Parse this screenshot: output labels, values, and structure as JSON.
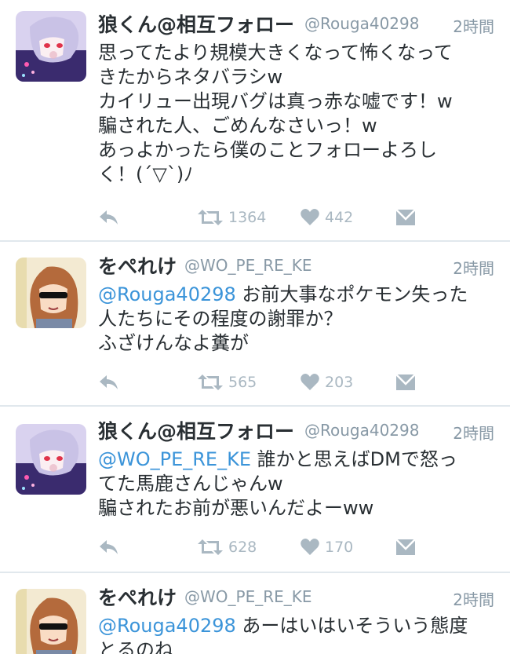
{
  "tweets": [
    {
      "name": "狼くん@相互フォロー",
      "handle": "@Rouga40298",
      "time": "2時間",
      "lines": [
        {
          "mention": "",
          "text": "思ってたより規模大きくなって怖くなって"
        },
        {
          "mention": "",
          "text": "きたからネタバラシw"
        },
        {
          "mention": "",
          "text": "カイリュー出現バグは真っ赤な嘘です！w"
        },
        {
          "mention": "",
          "text": "騙された人、ごめんなさいっ！w"
        },
        {
          "mention": "",
          "text": "あっよかったら僕のことフォローよろし"
        },
        {
          "mention": "",
          "text": "く！(´▽`)ﾉ"
        }
      ],
      "retweets": "1364",
      "likes": "442"
    },
    {
      "name": "をぺれけ",
      "handle": "@WO_PE_RE_KE",
      "time": "2時間",
      "lines": [
        {
          "mention": "@Rouga40298",
          "text": " お前大事なポケモン失った"
        },
        {
          "mention": "",
          "text": "人たちにその程度の謝罪か？"
        },
        {
          "mention": "",
          "text": "ふざけんなよ糞が"
        }
      ],
      "retweets": "565",
      "likes": "203"
    },
    {
      "name": "狼くん@相互フォロー",
      "handle": "@Rouga40298",
      "time": "2時間",
      "lines": [
        {
          "mention": "@WO_PE_RE_KE",
          "text": " 誰かと思えばDMで怒っ"
        },
        {
          "mention": "",
          "text": "てた馬鹿さんじゃんw"
        },
        {
          "mention": "",
          "text": "騙されたお前が悪いんだよーww"
        }
      ],
      "retweets": "628",
      "likes": "170"
    },
    {
      "name": "をぺれけ",
      "handle": "@WO_PE_RE_KE",
      "time": "2時間",
      "lines": [
        {
          "mention": "@Rouga40298",
          "text": " あーはいはいそういう態度"
        },
        {
          "mention": "",
          "text": "とるのね"
        }
      ]
    }
  ],
  "colors": {
    "text": "#292f33",
    "meta": "#8899a6",
    "link": "#3b94d9",
    "action": "#aab8c2",
    "divider": "#e1e8ed"
  },
  "icons": [
    "reply-icon",
    "retweet-icon",
    "like-icon",
    "direct-message-icon"
  ]
}
